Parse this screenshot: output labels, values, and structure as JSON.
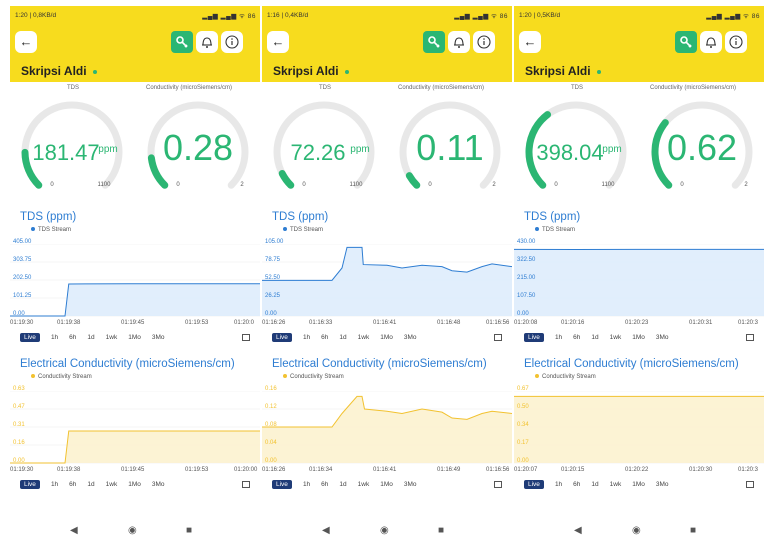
{
  "colors": {
    "yellow": "#f7dc1e",
    "green": "#2bb673",
    "blue": "#2e7dd2",
    "amber": "#f2c230"
  },
  "icons": {
    "back": "arrow-left-icon",
    "key": "key-icon",
    "bell": "bell-icon",
    "info": "info-icon"
  },
  "glyphs": {
    "back": "←",
    "key": "🔧",
    "bell": "🔔",
    "info": "ⓘ",
    "nav_back": "◀",
    "nav_home": "◉",
    "nav_recent": "■"
  },
  "common": {
    "title": "Skripsi Aldi",
    "tds_gauge_label": "TDS",
    "cond_gauge_label": "Conductivity (microSiemens/cm)",
    "tds_min": "0",
    "tds_max": "1100",
    "cond_min": "0",
    "cond_max": "2",
    "tds_unit": "ppm",
    "tds_chart_title": "TDS (ppm)",
    "tds_legend": "TDS Stream",
    "ec_chart_title": "Electrical Conductivity (microSiemens/cm)",
    "ec_legend": "Conductivity Stream",
    "ranges": [
      "Live",
      "1h",
      "6h",
      "1d",
      "1wk",
      "1Mo",
      "3Mo"
    ]
  },
  "panels": [
    {
      "status_left": "1:20 | 0,8KB/d",
      "status_right": "▂▄▆ ▂▄▆ ᯤ 86",
      "tds_value": "181.47",
      "tds_fraction": 0.165,
      "cond_value": "0.28",
      "cond_fraction": 0.14,
      "tds_chart": {
        "yticks": [
          "405.00",
          "303.75",
          "202.50",
          "101.25",
          "0.00"
        ],
        "ymax": 405,
        "xticks": [
          "01:19:30",
          "01:19:38",
          "01:19:45",
          "01:19:53",
          "01:20:0"
        ],
        "points": [
          [
            0,
            0
          ],
          [
            0.22,
            0
          ],
          [
            0.235,
            180
          ],
          [
            0.3,
            181
          ],
          [
            0.5,
            181.5
          ],
          [
            0.7,
            181.5
          ],
          [
            1,
            181.5
          ]
        ]
      },
      "ec_chart": {
        "yticks": [
          "0.63",
          "0.47",
          "0.31",
          "0.16",
          "0.00"
        ],
        "ymax": 0.63,
        "xticks": [
          "01:19:30",
          "01:19:38",
          "01:19:45",
          "01:19:53",
          "01:20:00"
        ],
        "points": [
          [
            0,
            0
          ],
          [
            0.22,
            0
          ],
          [
            0.235,
            0.28
          ],
          [
            0.5,
            0.28
          ],
          [
            1,
            0.28
          ]
        ]
      }
    },
    {
      "status_left": "1:16 | 0,4KB/d",
      "status_right": "▂▄▆ ▂▄▆ ᯤ 86",
      "tds_value": "72.26",
      "tds_fraction": 0.066,
      "cond_value": "0.11",
      "cond_fraction": 0.055,
      "tds_chart": {
        "yticks": [
          "105.00",
          "78.75",
          "52.50",
          "26.25",
          "0.00"
        ],
        "ymax": 105,
        "xticks": [
          "01:16:26",
          "01:16:33",
          "01:16:41",
          "01:16:48",
          "01:16:56"
        ],
        "points": [
          [
            0,
            52
          ],
          [
            0.28,
            52
          ],
          [
            0.32,
            70
          ],
          [
            0.34,
            100
          ],
          [
            0.4,
            100
          ],
          [
            0.405,
            75
          ],
          [
            0.5,
            74
          ],
          [
            0.56,
            70
          ],
          [
            0.64,
            74
          ],
          [
            0.72,
            72
          ],
          [
            0.76,
            66
          ],
          [
            0.82,
            64
          ],
          [
            0.88,
            72
          ],
          [
            0.92,
            76
          ],
          [
            1,
            72
          ]
        ]
      },
      "ec_chart": {
        "yticks": [
          "0.16",
          "0.12",
          "0.08",
          "0.04",
          "0.00"
        ],
        "ymax": 0.16,
        "xticks": [
          "01:16:26",
          "01:16:34",
          "01:16:41",
          "01:16:49",
          "01:16:56"
        ],
        "points": [
          [
            0,
            0.08
          ],
          [
            0.28,
            0.08
          ],
          [
            0.32,
            0.11
          ],
          [
            0.38,
            0.148
          ],
          [
            0.4,
            0.148
          ],
          [
            0.41,
            0.12
          ],
          [
            0.5,
            0.115
          ],
          [
            0.56,
            0.11
          ],
          [
            0.64,
            0.12
          ],
          [
            0.72,
            0.113
          ],
          [
            0.76,
            0.1
          ],
          [
            0.82,
            0.097
          ],
          [
            0.88,
            0.11
          ],
          [
            0.92,
            0.115
          ],
          [
            1,
            0.11
          ]
        ]
      }
    },
    {
      "status_left": "1:20 | 0,5KB/d",
      "status_right": "▂▄▆ ▂▄▆ ᯤ 86",
      "tds_value": "398.04",
      "tds_fraction": 0.362,
      "cond_value": "0.62",
      "cond_fraction": 0.31,
      "tds_chart": {
        "yticks": [
          "430.00",
          "322.50",
          "215.00",
          "107.50",
          "0.00"
        ],
        "ymax": 430,
        "xticks": [
          "01:20:08",
          "01:20:16",
          "01:20:23",
          "01:20:31",
          "01:20:3"
        ],
        "points": [
          [
            0,
            398
          ],
          [
            0.25,
            397.5
          ],
          [
            0.5,
            398
          ],
          [
            0.75,
            398
          ],
          [
            1,
            398
          ]
        ]
      },
      "ec_chart": {
        "yticks": [
          "0.67",
          "0.50",
          "0.34",
          "0.17",
          "0.00"
        ],
        "ymax": 0.67,
        "xticks": [
          "01:20:07",
          "01:20:15",
          "01:20:22",
          "01:20:30",
          "01:20:3"
        ],
        "points": [
          [
            0,
            0.62
          ],
          [
            0.5,
            0.62
          ],
          [
            1,
            0.62
          ]
        ]
      }
    }
  ]
}
